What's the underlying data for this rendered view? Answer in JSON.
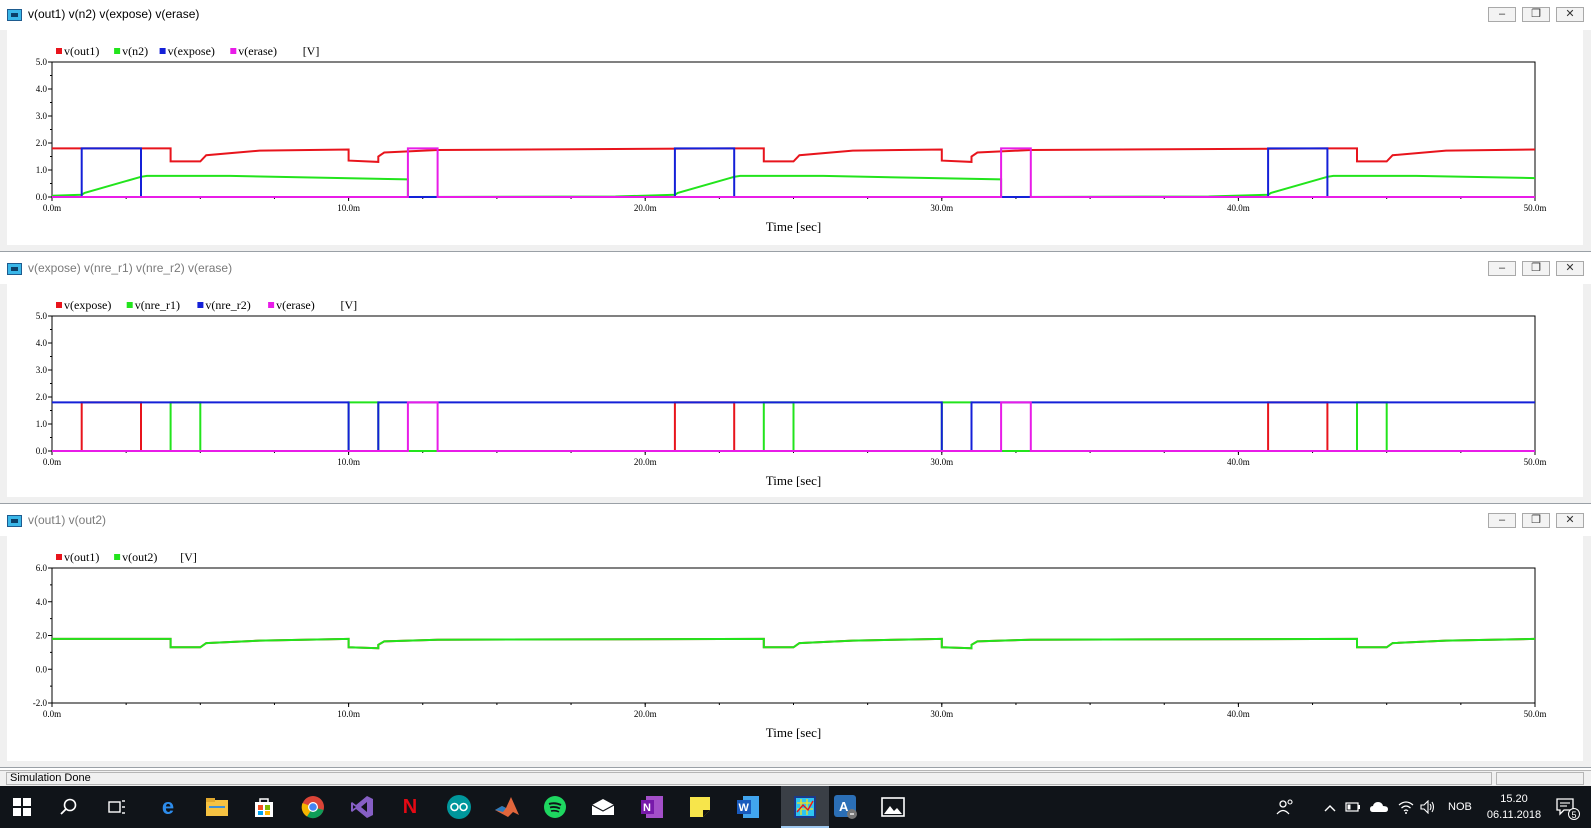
{
  "windows": [
    {
      "title": "v(out1) v(n2) v(expose) v(erase)",
      "active": true,
      "legend": [
        {
          "label": "v(out1)",
          "color": "#e8141c"
        },
        {
          "label": "v(n2)",
          "color": "#22e41c"
        },
        {
          "label": "v(expose)",
          "color": "#1420d8"
        },
        {
          "label": "v(erase)",
          "color": "#e81ce8"
        }
      ],
      "unit": "[V]",
      "xlabel": "Time [sec]",
      "ytick_labels": [
        "5.0",
        "4.0",
        "3.0",
        "2.0",
        "1.0",
        "0.0"
      ],
      "xtick_labels": [
        "0.0m",
        "10.0m",
        "20.0m",
        "30.0m",
        "40.0m",
        "50.0m"
      ]
    },
    {
      "title": "v(expose) v(nre_r1) v(nre_r2) v(erase)",
      "active": false,
      "legend": [
        {
          "label": "v(expose)",
          "color": "#e8141c"
        },
        {
          "label": "v(nre_r1)",
          "color": "#22e41c"
        },
        {
          "label": "v(nre_r2)",
          "color": "#1420d8"
        },
        {
          "label": "v(erase)",
          "color": "#e81ce8"
        }
      ],
      "unit": "[V]",
      "xlabel": "Time [sec]",
      "ytick_labels": [
        "5.0",
        "4.0",
        "3.0",
        "2.0",
        "1.0",
        "0.0"
      ],
      "xtick_labels": [
        "0.0m",
        "10.0m",
        "20.0m",
        "30.0m",
        "40.0m",
        "50.0m"
      ]
    },
    {
      "title": "v(out1) v(out2)",
      "active": false,
      "legend": [
        {
          "label": "v(out1)",
          "color": "#e8141c"
        },
        {
          "label": "v(out2)",
          "color": "#22e41c"
        }
      ],
      "unit": "[V]",
      "xlabel": "Time [sec]",
      "ytick_labels": [
        "6.0",
        "4.0",
        "2.0",
        "0.0",
        "-2.0"
      ],
      "xtick_labels": [
        "0.0m",
        "10.0m",
        "20.0m",
        "30.0m",
        "40.0m",
        "50.0m"
      ]
    }
  ],
  "window_buttons": {
    "minimize": "–",
    "restore": "❐",
    "close": "✕"
  },
  "status": {
    "text": "Simulation Done"
  },
  "taskbar": {
    "apps": [
      "windows-start",
      "search",
      "task-view",
      "edge",
      "file-explorer",
      "store",
      "chrome",
      "visual-studio",
      "netflix",
      "arduino",
      "matlab",
      "spotify",
      "mail",
      "onenote",
      "sticky-notes",
      "word",
      "ltspice",
      "autodesk",
      "photos"
    ],
    "language": "NOB",
    "time": "15.20",
    "date": "06.11.2018",
    "notification_count": "5"
  },
  "chart_data": [
    {
      "type": "line",
      "xlabel": "Time [sec]",
      "xlim": [
        0,
        50
      ],
      "x_unit": "ms",
      "ylim": [
        0,
        5
      ],
      "ylabel": "[V]",
      "series": [
        {
          "name": "v(out1)",
          "color": "#e8141c",
          "x": [
            0,
            4,
            4,
            5,
            5.2,
            7,
            10,
            10,
            11,
            11,
            11.2,
            13,
            23,
            24,
            24,
            25,
            25.2,
            27,
            30,
            30,
            31,
            31,
            31.2,
            33,
            43,
            44,
            44,
            45,
            45.2,
            47,
            50
          ],
          "y": [
            1.8,
            1.8,
            1.32,
            1.32,
            1.55,
            1.72,
            1.76,
            1.35,
            1.3,
            1.5,
            1.65,
            1.74,
            1.8,
            1.8,
            1.32,
            1.32,
            1.55,
            1.72,
            1.76,
            1.35,
            1.3,
            1.5,
            1.65,
            1.74,
            1.8,
            1.8,
            1.32,
            1.32,
            1.55,
            1.72,
            1.76
          ]
        },
        {
          "name": "v(n2)",
          "color": "#22e41c",
          "x": [
            0,
            1,
            1.1,
            3,
            3.2,
            6,
            12,
            12,
            19,
            21,
            21.1,
            23,
            23.2,
            26,
            32,
            32,
            39,
            41,
            41.1,
            43,
            43.2,
            46,
            50
          ],
          "y": [
            0.05,
            0.08,
            0.15,
            0.75,
            0.78,
            0.78,
            0.65,
            0.0,
            0.02,
            0.08,
            0.15,
            0.75,
            0.78,
            0.78,
            0.65,
            0.0,
            0.02,
            0.08,
            0.15,
            0.75,
            0.78,
            0.78,
            0.7
          ]
        },
        {
          "name": "v(expose)",
          "color": "#1420d8",
          "x": [
            0,
            1,
            1,
            3,
            3,
            21,
            21,
            23,
            23,
            41,
            41,
            43,
            43,
            50
          ],
          "y": [
            0,
            0,
            1.8,
            1.8,
            0,
            0,
            1.8,
            1.8,
            0,
            0,
            1.8,
            1.8,
            0,
            0
          ]
        },
        {
          "name": "v(erase)",
          "color": "#e81ce8",
          "x": [
            0,
            12,
            12,
            13,
            13,
            32,
            32,
            33,
            33,
            50
          ],
          "y": [
            0,
            0,
            1.8,
            1.8,
            0,
            0,
            1.8,
            1.8,
            0,
            0
          ]
        }
      ]
    },
    {
      "type": "line",
      "xlabel": "Time [sec]",
      "xlim": [
        0,
        50
      ],
      "x_unit": "ms",
      "ylim": [
        0,
        5
      ],
      "ylabel": "[V]",
      "series": [
        {
          "name": "v(expose)",
          "color": "#e8141c",
          "x": [
            0,
            1,
            1,
            3,
            3,
            21,
            21,
            23,
            23,
            41,
            41,
            43,
            43,
            50
          ],
          "y": [
            0,
            0,
            1.8,
            1.8,
            0,
            0,
            1.8,
            1.8,
            0,
            0,
            1.8,
            1.8,
            0,
            0
          ]
        },
        {
          "name": "v(nre_r1)",
          "color": "#22e41c",
          "x": [
            0,
            4,
            4,
            5,
            5,
            10,
            10,
            11,
            11,
            24,
            24,
            25,
            25,
            30,
            30,
            31,
            31,
            44,
            44,
            45,
            45,
            50
          ],
          "y": [
            0,
            0,
            1.8,
            1.8,
            0,
            0,
            1.8,
            1.8,
            0,
            0,
            1.8,
            1.8,
            0,
            0,
            1.8,
            1.8,
            0,
            0,
            1.8,
            1.8,
            0,
            0
          ]
        },
        {
          "name": "v(nre_r2)",
          "color": "#1420d8",
          "x": [
            0,
            10,
            10,
            11,
            11,
            30,
            30,
            31,
            31,
            50
          ],
          "y": [
            1.8,
            1.8,
            0,
            0,
            1.8,
            1.8,
            0,
            0,
            1.8,
            1.8
          ]
        },
        {
          "name": "v(erase)",
          "color": "#e81ce8",
          "x": [
            0,
            12,
            12,
            13,
            13,
            32,
            32,
            33,
            33,
            50
          ],
          "y": [
            0,
            0,
            1.8,
            1.8,
            0,
            0,
            1.8,
            1.8,
            0,
            0
          ]
        }
      ]
    },
    {
      "type": "line",
      "xlabel": "Time [sec]",
      "xlim": [
        0,
        50
      ],
      "x_unit": "ms",
      "ylim": [
        -2,
        6
      ],
      "ylabel": "[V]",
      "series": [
        {
          "name": "v(out1)",
          "color": "#e8141c",
          "x": [
            0,
            4,
            4,
            5,
            5.2,
            7,
            10,
            10,
            11,
            11,
            11.2,
            13,
            24,
            24,
            25,
            25.2,
            27,
            30,
            30,
            31,
            31,
            31.2,
            33,
            44,
            44,
            45,
            45.2,
            47,
            50
          ],
          "y": [
            1.8,
            1.8,
            1.3,
            1.3,
            1.55,
            1.7,
            1.8,
            1.3,
            1.25,
            1.45,
            1.65,
            1.75,
            1.8,
            1.3,
            1.3,
            1.55,
            1.7,
            1.8,
            1.3,
            1.25,
            1.45,
            1.65,
            1.75,
            1.8,
            1.3,
            1.3,
            1.55,
            1.7,
            1.8
          ]
        },
        {
          "name": "v(out2)",
          "color": "#22e41c",
          "x": [
            0,
            4,
            4,
            5,
            5.2,
            7,
            10,
            10,
            11,
            11,
            11.2,
            13,
            24,
            24,
            25,
            25.2,
            27,
            30,
            30,
            31,
            31,
            31.2,
            33,
            44,
            44,
            45,
            45.2,
            47,
            50
          ],
          "y": [
            1.8,
            1.8,
            1.3,
            1.3,
            1.55,
            1.7,
            1.8,
            1.3,
            1.25,
            1.45,
            1.65,
            1.75,
            1.8,
            1.3,
            1.3,
            1.55,
            1.7,
            1.8,
            1.3,
            1.25,
            1.45,
            1.65,
            1.75,
            1.8,
            1.3,
            1.3,
            1.55,
            1.7,
            1.8
          ]
        }
      ]
    }
  ]
}
